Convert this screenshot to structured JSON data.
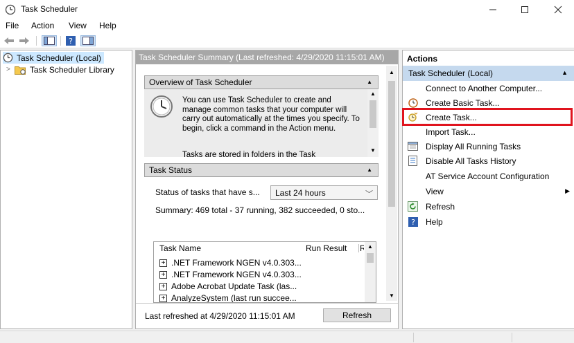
{
  "window": {
    "title": "Task Scheduler"
  },
  "menu": {
    "items": [
      {
        "key": "file",
        "label": "File"
      },
      {
        "key": "action",
        "label": "Action"
      },
      {
        "key": "view",
        "label": "View"
      },
      {
        "key": "help",
        "label": "Help"
      }
    ]
  },
  "tree": {
    "root": "Task Scheduler (Local)",
    "library": "Task Scheduler Library"
  },
  "center": {
    "header": "Task Scheduler Summary (Last refreshed: 4/29/2020 11:15:01 AM)",
    "overview": {
      "title": "Overview of Task Scheduler",
      "paragraph1": "You can use Task Scheduler to create and manage common tasks that your computer will carry out automatically at the times you specify. To begin, click a command in the Action menu.",
      "paragraph2": "Tasks are stored in folders in the Task"
    },
    "status": {
      "title": "Task Status",
      "filter_label": "Status of tasks that have s...",
      "filter_value": "Last 24 hours",
      "summary": "Summary: 469 total - 37 running, 382 succeeded, 0 sto...",
      "columns": [
        "Task Name",
        "Run Result",
        "R"
      ],
      "tasks": [
        ".NET Framework NGEN v4.0.303...",
        ".NET Framework NGEN v4.0.303...",
        "Adobe Acrobat Update Task (las...",
        "AnalyzeSystem (last run succee..."
      ]
    },
    "footer": {
      "last_refreshed": "Last refreshed at 4/29/2020 11:15:01 AM",
      "refresh_button": "Refresh"
    }
  },
  "actions": {
    "title": "Actions",
    "section": "Task Scheduler (Local)",
    "items": [
      {
        "label": "Connect to Another Computer...",
        "icon": "none"
      },
      {
        "label": "Create Basic Task...",
        "icon": "wizard-clock-icon"
      },
      {
        "label": "Create Task...",
        "icon": "create-task-icon"
      },
      {
        "label": "Import Task...",
        "icon": "none"
      },
      {
        "label": "Display All Running Tasks",
        "icon": "running-tasks-icon"
      },
      {
        "label": "Disable All Tasks History",
        "icon": "history-icon"
      },
      {
        "label": "AT Service Account Configuration",
        "icon": "none"
      },
      {
        "label": "View",
        "icon": "none"
      },
      {
        "label": "Refresh",
        "icon": "refresh-icon"
      },
      {
        "label": "Help",
        "icon": "help-icon"
      }
    ],
    "highlighted": "Create Task..."
  },
  "colors": {
    "section_bg": "#c5d9ee",
    "center_header_bg": "#a7a7a7",
    "highlight_border": "#e0141e",
    "tree_selected_bg": "#cce8ff"
  }
}
